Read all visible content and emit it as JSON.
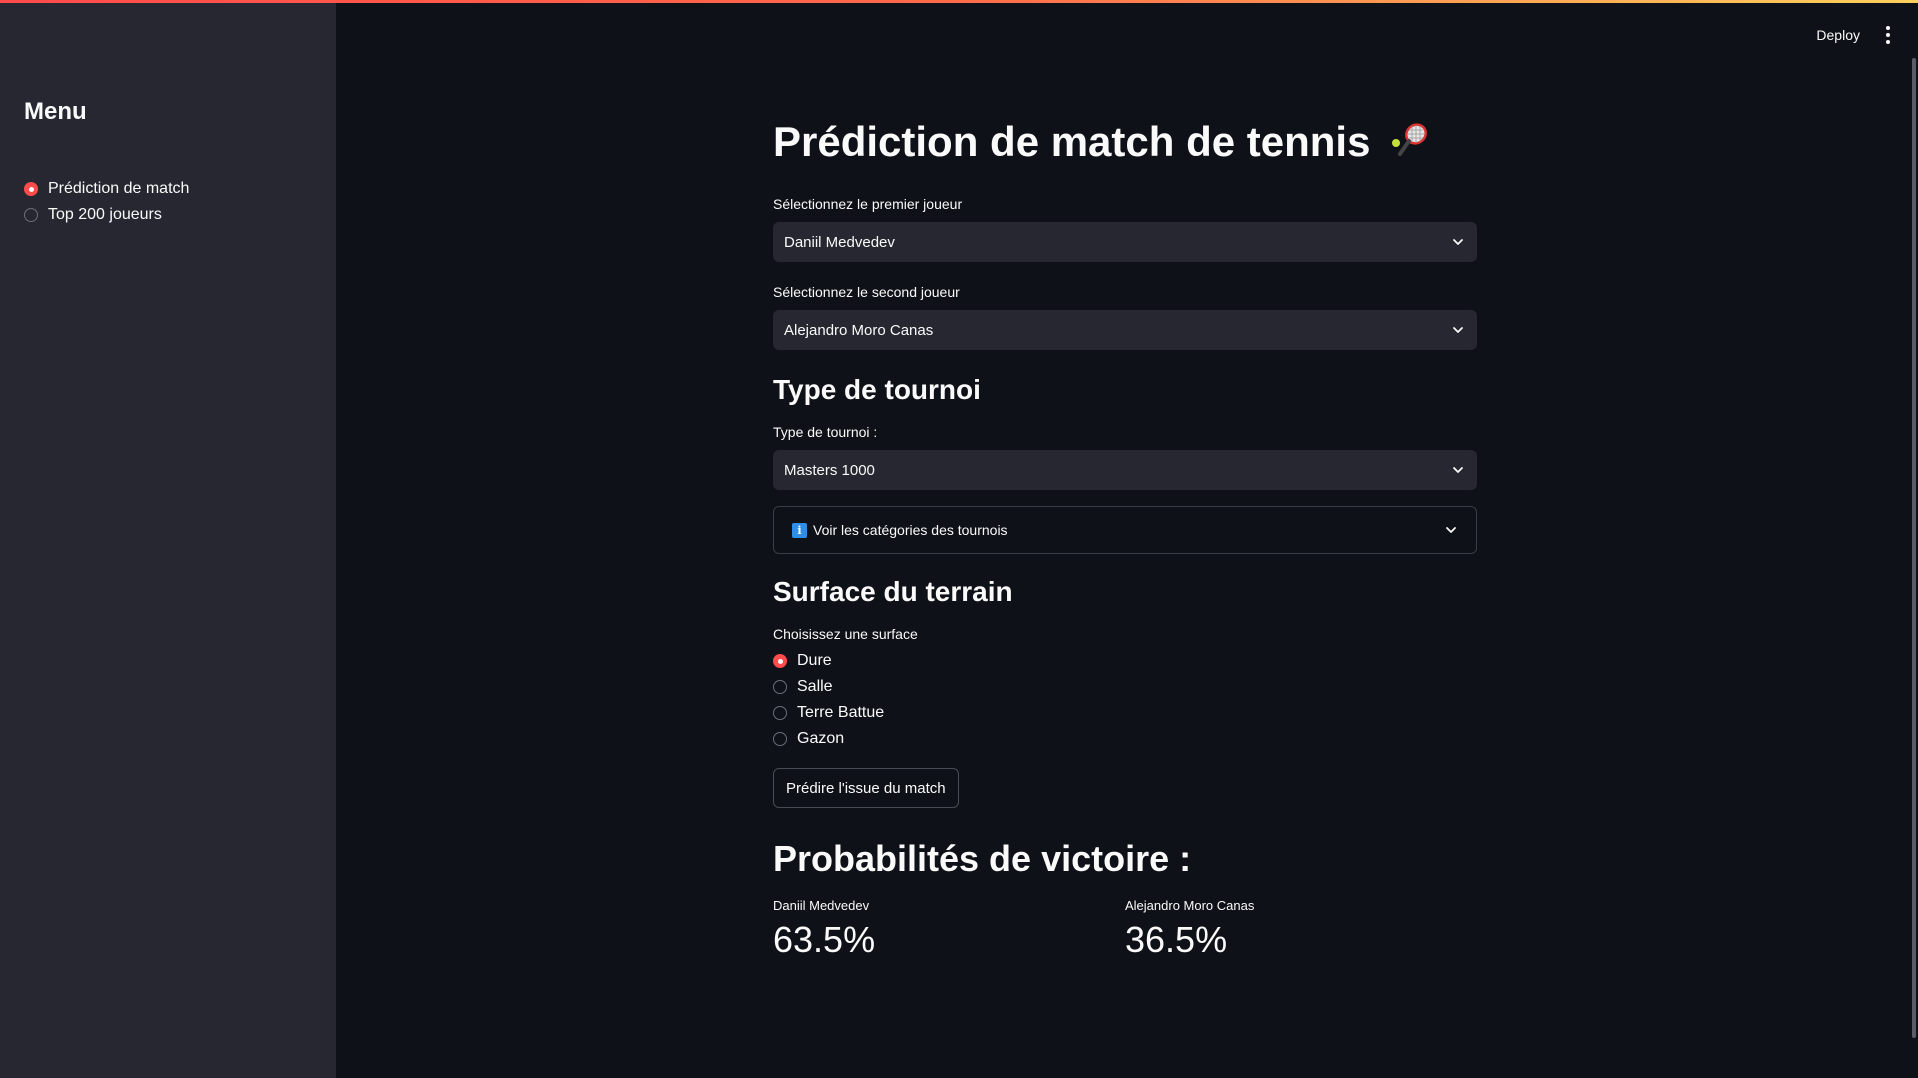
{
  "sidebar": {
    "title": "Menu",
    "items": [
      {
        "label": "Prédiction de match",
        "selected": true
      },
      {
        "label": "Top 200 joueurs",
        "selected": false
      }
    ]
  },
  "header": {
    "deploy_label": "Deploy",
    "menu_icon": "kebab-menu-icon"
  },
  "main": {
    "title": "Prédiction de match de tennis",
    "title_icon": "tennis-racket-icon",
    "player1": {
      "label": "Sélectionnez le premier joueur",
      "value": "Daniil Medvedev"
    },
    "player2": {
      "label": "Sélectionnez le second joueur",
      "value": "Alejandro Moro Canas"
    },
    "tournament_section": "Type de tournoi",
    "tournament": {
      "label": "Type de tournoi :",
      "value": "Masters 1000"
    },
    "expander_label": "Voir les catégories des tournois",
    "surface_section": "Surface du terrain",
    "surface": {
      "label": "Choisissez une surface",
      "options": [
        {
          "label": "Dure",
          "selected": true
        },
        {
          "label": "Salle",
          "selected": false
        },
        {
          "label": "Terre Battue",
          "selected": false
        },
        {
          "label": "Gazon",
          "selected": false
        }
      ]
    },
    "predict_button": "Prédire l'issue du match",
    "prob_heading": "Probabilités de victoire :",
    "metrics": [
      {
        "label": "Daniil Medvedev",
        "value": "63.5%"
      },
      {
        "label": "Alejandro Moro Canas",
        "value": "36.5%"
      }
    ]
  },
  "colors": {
    "accent": "#ff4b4b",
    "background": "#0e1117",
    "sidebar": "#262730",
    "input": "#262730"
  }
}
